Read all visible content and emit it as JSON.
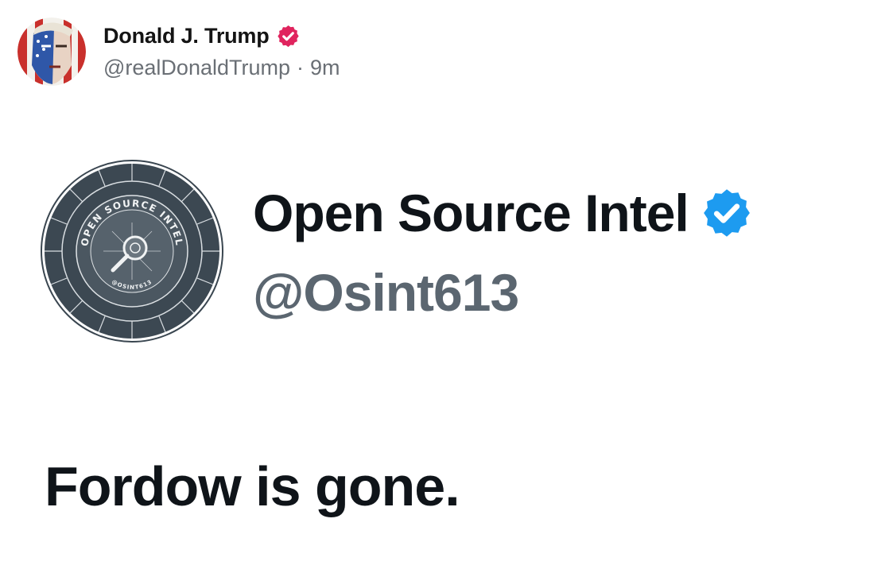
{
  "post": {
    "author_name": "Donald J. Trump",
    "author_handle": "@realDonaldTrump",
    "separator": "·",
    "timestamp": "9m",
    "verified_color": "#e0245e"
  },
  "embed": {
    "account_name": "Open Source Intel",
    "account_handle": "@Osint613",
    "verified_color": "#1d9bf0",
    "logo_ring_text": "OPEN SOURCE INTEL",
    "logo_bottom_text": "@OSINT613",
    "tweet_text": "Fordow is gone."
  },
  "icons": {
    "avatar": "portrait-avatar",
    "author_badge": "verified-badge-icon",
    "embed_logo": "osint-logo",
    "embed_badge": "verified-badge-icon"
  }
}
